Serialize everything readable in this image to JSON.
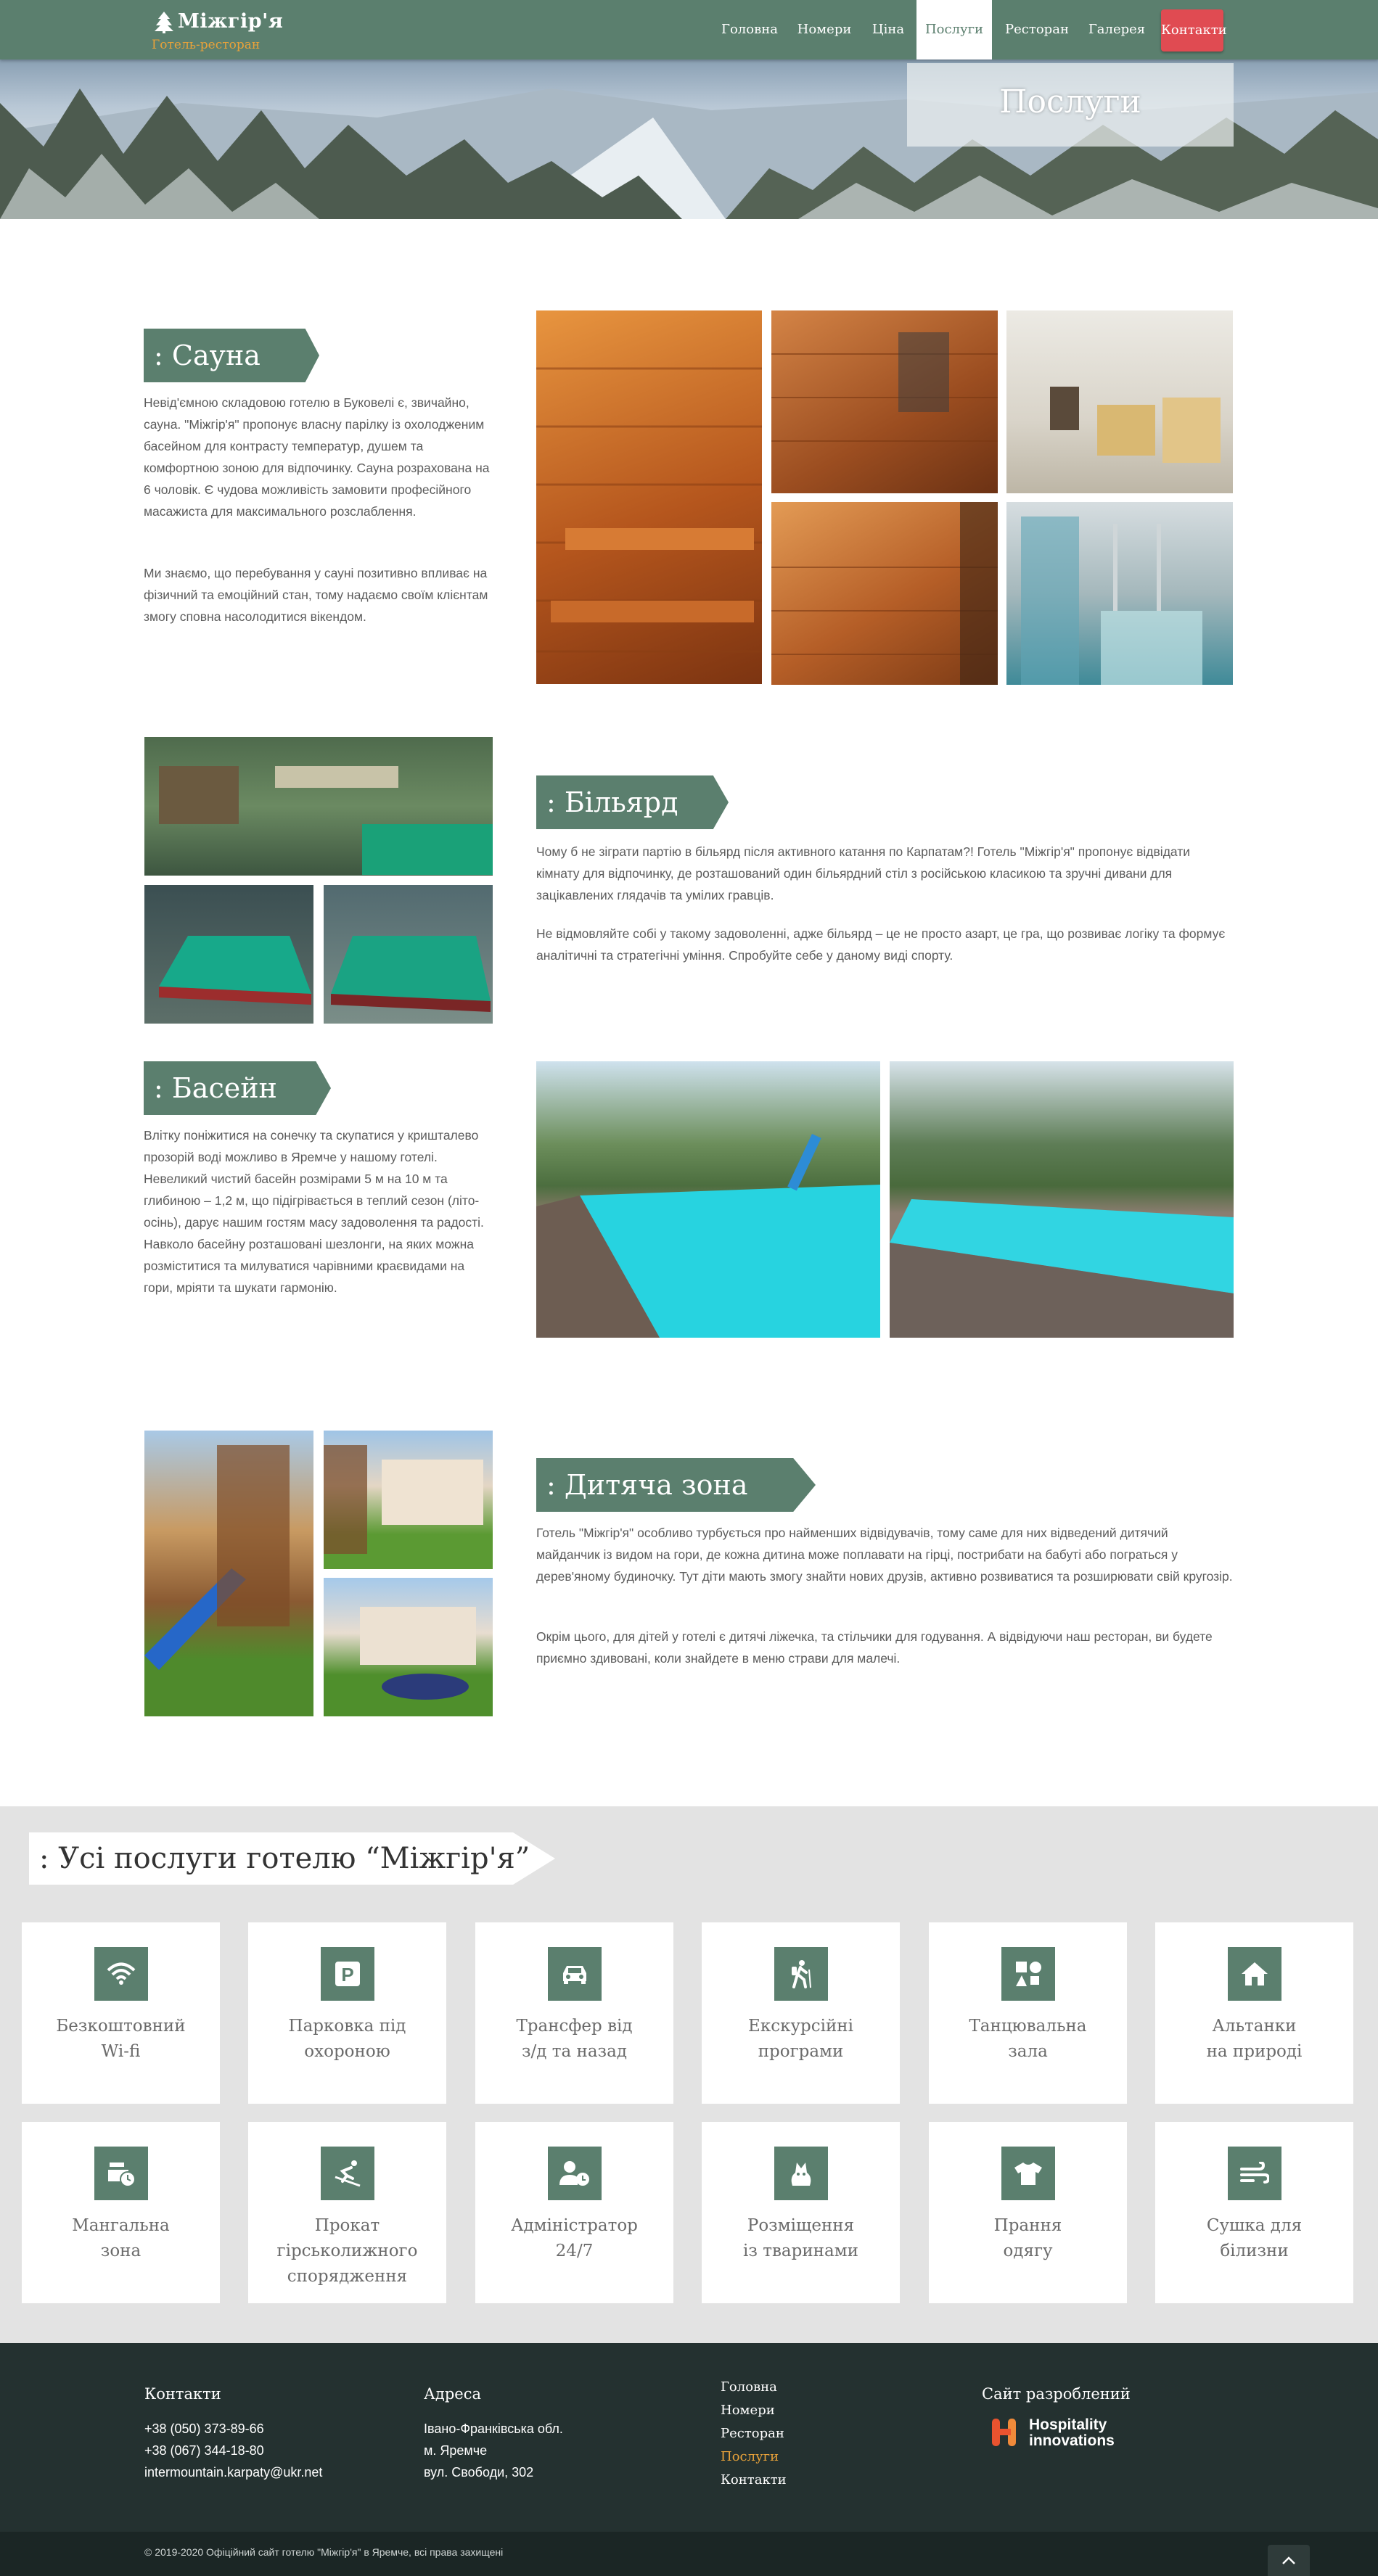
{
  "header": {
    "logo_name": "Міжгір'я",
    "logo_sub": "Готель-ресторан",
    "nav": [
      {
        "label": "Головна",
        "active": false
      },
      {
        "label": "Номери",
        "active": false
      },
      {
        "label": "Ціна",
        "active": false
      },
      {
        "label": "Послуги",
        "active": true
      },
      {
        "label": "Ресторан",
        "active": false
      },
      {
        "label": "Галерея",
        "active": false
      }
    ],
    "contact_label": "Контакти"
  },
  "hero": {
    "title": "Послуги"
  },
  "sauna": {
    "title": ": Сауна",
    "p1": "Невід'ємною складовою готелю в Буковелі є, звичайно, сауна. \"Міжгір'я\" пропонує власну парілку із охолодженим басейном для контрасту температур, душем та комфортною зоною для відпочинку. Сауна розрахована на 6 чоловік. Є чудова можливість замовити професійного масажиста для максимального розслаблення.",
    "p2": "Ми знаємо, що перебування у сауні позитивно впливає на фізичний та емоційний стан, тому надаємо своїм клієнтам змогу сповна насолодитися вікендом."
  },
  "billiard": {
    "title": ": Більярд",
    "p1": "Чому б не зіграти партію в більярд після активного катання по Карпатам?! Готель \"Міжгір'я\" пропонує відвідати кімнату для відпочинку, де розташований один більярдний стіл з російською класикою та зручні дивани для зацікавлених глядачів та умілих гравців.",
    "p2": "Не відмовляйте собі у такому задоволенні, адже більярд  – це не просто азарт, це гра, що розвиває логіку та формує аналітичні та стратегічні уміння. Спробуйте себе у даному виді спорту."
  },
  "pool": {
    "title": ": Басейн",
    "p1": "Влітку поніжитися на сонечку та скупатися у кришталево прозорій воді можливо в Яремче у нашому готелі. Невеликий чистий басейн розмірами 5 м на 10 м та глибиною – 1,2 м, що підігрівається в теплий сезон (літо-осінь), дарує нашим гостям масу задоволення та радості. Навколо басейну розташовані шезлонги, на яких можна розміститися та милуватися чарівними краєвидами на гори, мріяти та шукати гармонію."
  },
  "kids": {
    "title": ": Дитяча зона",
    "p1": "Готель \"Міжгір'я\" особливо турбується про найменших відвідувачів, тому саме для них відведений дитячий майданчик із видом на гори, де кожна дитина може поплавати на гірці, пострибати на бабуті або пограться у дерев'яному будиночку. Тут діти мають змогу знайти нових друзів, активно розвиватися та розширювати свій кругозір.",
    "p2": "Окрім цього, для дітей у готелі є дитячі ліжечка, та стільчики для годування. А відвідуючи наш ресторан, ви будете приємно здивовані, коли знайдете в меню страви для малечі."
  },
  "services": {
    "title": ": Усі послуги готелю “Міжгір'я”",
    "items": [
      {
        "label": "Безкоштовний\nWi-fi",
        "icon": "wifi-icon"
      },
      {
        "label": "Парковка під\nохороною",
        "icon": "parking-icon"
      },
      {
        "label": "Трансфер від\nз/д та назад",
        "icon": "car-icon"
      },
      {
        "label": "Екскурсійні\nпрограми",
        "icon": "hiking-icon"
      },
      {
        "label": "Танцювальна\nзала",
        "icon": "dance-icon"
      },
      {
        "label": "Альтанки\nна природі",
        "icon": "house-icon"
      },
      {
        "label": "Мангальна\nзона",
        "icon": "grill-icon"
      },
      {
        "label": "Прокат\nгірськолижного\nспорядження",
        "icon": "skiing-icon"
      },
      {
        "label": "Адміністратор\n24/7",
        "icon": "admin-clock-icon"
      },
      {
        "label": "Розміщення\nіз тваринами",
        "icon": "pet-icon"
      },
      {
        "label": "Прання\nодягу",
        "icon": "tshirt-icon"
      },
      {
        "label": "Сушка для\nбілизни",
        "icon": "wind-icon"
      }
    ]
  },
  "footer": {
    "contacts_title": "Контакти",
    "phone1": "+38 (050) 373-89-66",
    "phone2": "+38 (067) 344-18-80",
    "email": "intermountain.karpaty@ukr.net",
    "address_title": "Адреса",
    "addr1": "Івано-Франківська обл.",
    "addr2": "м. Яремче",
    "addr3": "вул. Свободи, 302",
    "nav": [
      {
        "label": "Головна",
        "active": false
      },
      {
        "label": "Номери",
        "active": false
      },
      {
        "label": "Ресторан",
        "active": false
      },
      {
        "label": "Послуги",
        "active": true
      },
      {
        "label": "Контакти",
        "active": false
      }
    ],
    "dev_title": "Сайт разроблений",
    "dev_name1": "Hospitality",
    "dev_name2": "innovations",
    "copyright": "© 2019-2020 Офіційний сайт готелю \"Міжгір'я\" в Яремче, всі права захищені"
  },
  "colors": {
    "brand_green": "#5b7f6e",
    "contact_red": "#e04b52",
    "footer_dark": "#243130",
    "active_link": "#e8a23a"
  }
}
